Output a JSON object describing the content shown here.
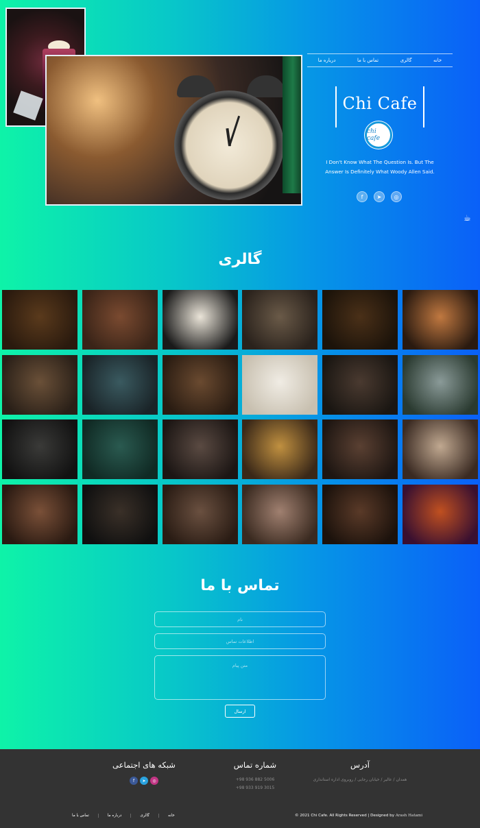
{
  "nav": {
    "items": [
      "خانه",
      "گالری",
      "تماس با ما",
      "درباره ما"
    ]
  },
  "brand": {
    "title": "Chi Cafe",
    "logo_text": "chi cafe"
  },
  "hero": {
    "quote": "I Don't Know What The Question Is. But The Answer Is Definitely What Woody Allen Said."
  },
  "social_icons": [
    "facebook-icon",
    "telegram-icon",
    "instagram-icon"
  ],
  "gallery": {
    "title": "گالری",
    "tiles": [
      [
        "#5a3a1c",
        "#2a1a0e"
      ],
      [
        "#7a4a30",
        "#3a2418"
      ],
      [
        "#eae4d8",
        "#1a1a1a"
      ],
      [
        "#6a5a48",
        "#2a221c"
      ],
      [
        "#4a3018",
        "#1c130a"
      ],
      [
        "#c07840",
        "#2a1a10"
      ],
      [
        "#6a5038",
        "#2a2018"
      ],
      [
        "#3a5a60",
        "#1a2428"
      ],
      [
        "#6a4a30",
        "#2a1c12"
      ],
      [
        "#f0ece4",
        "#c8c0b0"
      ],
      [
        "#4a3a30",
        "#1a1612"
      ],
      [
        "#8a9a98",
        "#2a3a30"
      ],
      [
        "#3a3a38",
        "#121212"
      ],
      [
        "#2a5a50",
        "#102a24"
      ],
      [
        "#5a4a42",
        "#1c1614"
      ],
      [
        "#c09040",
        "#3a2818"
      ],
      [
        "#5a4032",
        "#1e1612"
      ],
      [
        "#c0a890",
        "#3a2a22"
      ],
      [
        "#7a5038",
        "#2a1a12"
      ],
      [
        "#3a3028",
        "#101010"
      ],
      [
        "#6a5040",
        "#2a1c14"
      ],
      [
        "#a08070",
        "#3a2a20"
      ],
      [
        "#5a3a28",
        "#1c120c"
      ],
      [
        "#c05020",
        "#3a1030"
      ]
    ]
  },
  "contact": {
    "title": "تماس با ما",
    "name_placeholder": "نام",
    "contact_placeholder": "اطلاعات تماس",
    "message_placeholder": "متن پیام",
    "send_label": "ارسال"
  },
  "footer": {
    "address_title": "آدرس",
    "address_text": "همدان / عالیر / خیابان رجایی / روبروی اداره استانداری",
    "phone_title": "شماره تماس",
    "phones": [
      "+98 936 882 5006",
      "+98 933 919 3015"
    ],
    "social_title": "شبکه های اجتماعی",
    "nav": [
      "خانه",
      "گالری",
      "درباره ما",
      "تماس با ما"
    ],
    "copyright": "© 2021 Chi Cafe. All Rights Reserved | Designed by",
    "designer": "Arash Hatami"
  },
  "colors": {
    "gradient_start": "#0ef3a8",
    "gradient_end": "#0a60f8",
    "footer_bg": "#333333"
  }
}
